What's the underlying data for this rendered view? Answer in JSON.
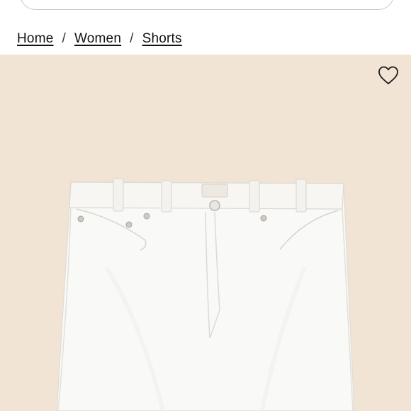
{
  "search": {
    "placeholder": ""
  },
  "breadcrumb": {
    "items": [
      {
        "label": "Home"
      },
      {
        "label": "Women"
      },
      {
        "label": "Shorts"
      }
    ],
    "separator": "/"
  },
  "product": {
    "image_subject": "white denim shorts",
    "image_background": "#f2e4d4",
    "wishlist_icon": "heart-outline-icon"
  }
}
